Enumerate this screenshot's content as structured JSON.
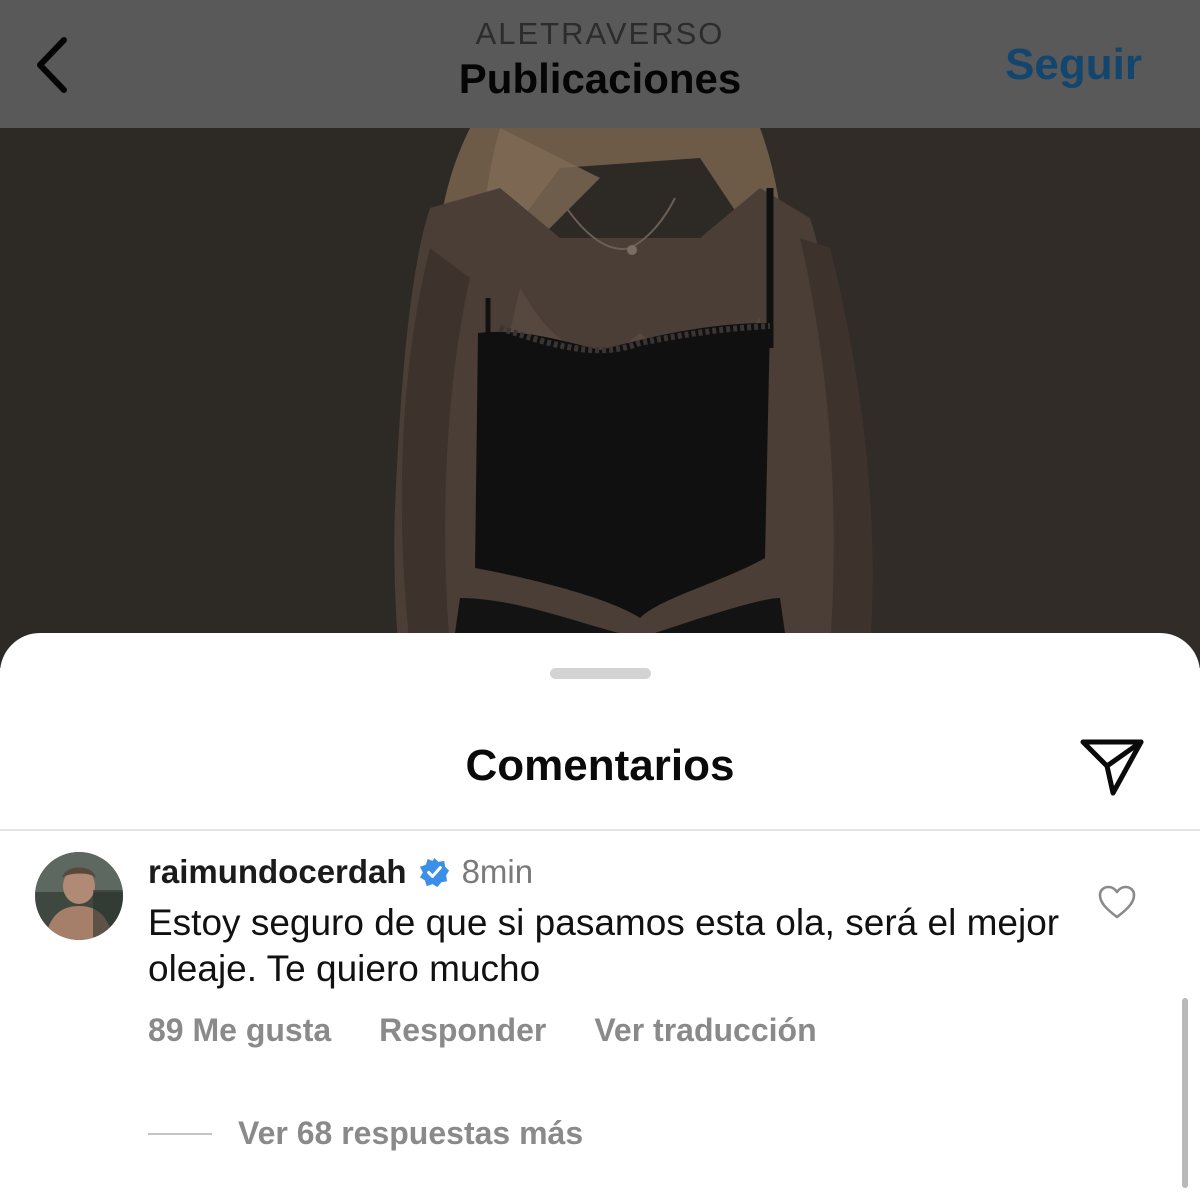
{
  "header": {
    "account_name": "ALETRAVERSO",
    "title": "Publicaciones",
    "follow_label": "Seguir",
    "back_icon": "chevron-left-icon"
  },
  "post": {
    "image_description_icon": "post-photo"
  },
  "comments_sheet": {
    "title": "Comentarios",
    "share_icon": "paper-plane-icon"
  },
  "comment": {
    "username": "raimundocerdah",
    "verified_icon": "verified-badge-icon",
    "time": "8min",
    "text": "Estoy seguro de que si pasamos esta ola, será el mejor oleaje. Te quiero mucho",
    "likes_label": "89 Me gusta",
    "reply_label": "Responder",
    "translate_label": "Ver traducción",
    "like_icon": "heart-outline-icon",
    "view_replies_label": "Ver 68 respuestas más"
  },
  "colors": {
    "follow": "#12466f",
    "verified": "#3b8fe6",
    "dim_overlay": "#595959"
  }
}
